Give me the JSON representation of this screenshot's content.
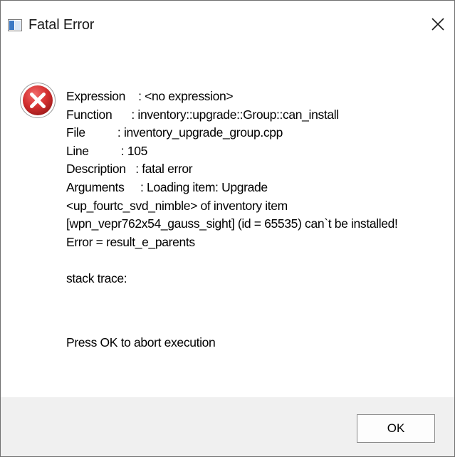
{
  "window": {
    "title": "Fatal Error"
  },
  "icons": {
    "app": "app-window-icon",
    "close": "close-icon",
    "error": "error-icon"
  },
  "message": {
    "lines": [
      "Expression    : <no expression>",
      "Function      : inventory::upgrade::Group::can_install",
      "File          : inventory_upgrade_group.cpp",
      "Line          : 105",
      "Description   : fatal error",
      "Arguments     : Loading item: Upgrade",
      "<up_fourtc_svd_nimble> of inventory item",
      "[wpn_vepr762x54_gauss_sight] (id = 65535) can`t be installed!",
      "Error = result_e_parents"
    ],
    "stack_trace_label": "stack trace:",
    "prompt": "Press OK to abort execution"
  },
  "buttons": {
    "ok_label": "OK"
  },
  "colors": {
    "error_red": "#d32f2f",
    "footer_bg": "#f0f0f0",
    "window_bg": "#ffffff"
  }
}
